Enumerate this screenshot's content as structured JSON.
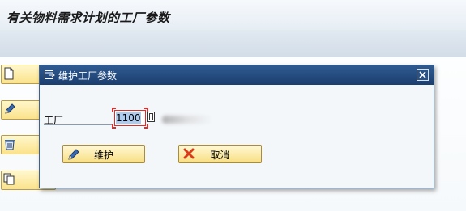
{
  "screen": {
    "title": "有关物料需求计划的工厂参数"
  },
  "dialog": {
    "title": "维护工厂参数",
    "plant_label": "工厂",
    "plant_value": "1100",
    "maintain_label": "维护",
    "cancel_label": "取消"
  },
  "colors": {
    "dialog_titlebar": "#1f4577",
    "button_yellow": "#fbe38a",
    "error_red": "#e02b2b",
    "cancel_icon_red": "#d83a1a"
  },
  "icons": {
    "bg_buttons": [
      "create-document-icon",
      "pencil-icon",
      "trash-icon",
      "copy-icon"
    ],
    "dialog": [
      "dialog-window-icon",
      "close-icon",
      "dropdown-value-help-icon",
      "pencil-icon",
      "cancel-x-icon"
    ]
  }
}
